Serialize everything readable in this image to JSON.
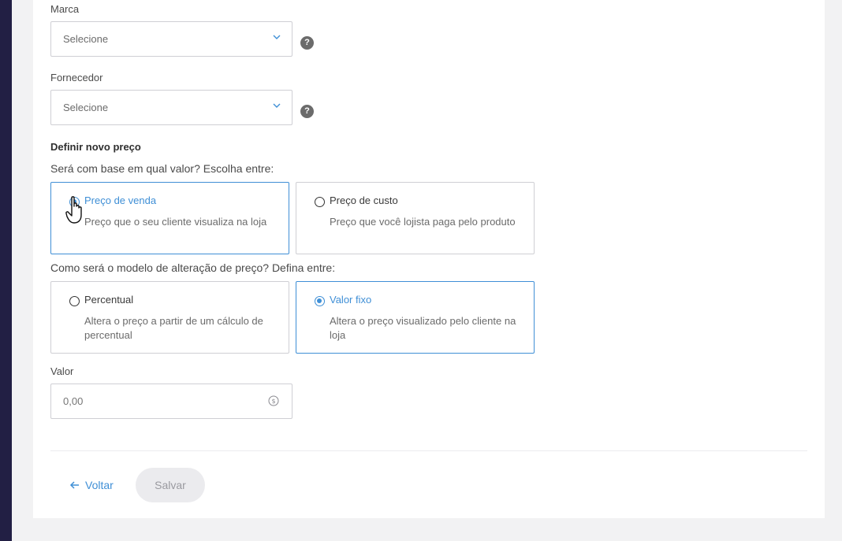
{
  "brand": {
    "label": "Marca",
    "placeholder": "Selecione",
    "help_icon": "question-icon"
  },
  "supplier": {
    "label": "Fornecedor",
    "placeholder": "Selecione",
    "help_icon": "question-icon"
  },
  "help_glyph": "?",
  "price_section": {
    "title": "Definir novo preço",
    "base_question": "Será com base em qual valor? Escolha entre:",
    "base_options": [
      {
        "title": "Preço de venda",
        "description": "Preço que o seu cliente visualiza na loja",
        "selected": true
      },
      {
        "title": "Preço de custo",
        "description": "Preço que você lojista paga pelo produto",
        "selected": false
      }
    ],
    "model_question": "Como será o modelo de alteração de preço? Defina entre:",
    "model_options": [
      {
        "title": "Percentual",
        "description": "Altera o preço a partir de um cálculo de percentual",
        "selected": false
      },
      {
        "title": "Valor fixo",
        "description": "Altera o preço visualizado pelo cliente na loja",
        "selected": true
      }
    ]
  },
  "value_field": {
    "label": "Valor",
    "placeholder": "0,00",
    "icon": "dollar-coin-icon"
  },
  "actions": {
    "back_label": "Voltar",
    "save_label": "Salvar"
  },
  "colors": {
    "accent": "#3f8fd6",
    "sidebar": "#221f44",
    "border": "#cfcfd4",
    "disabled_bg": "#ebebee"
  }
}
